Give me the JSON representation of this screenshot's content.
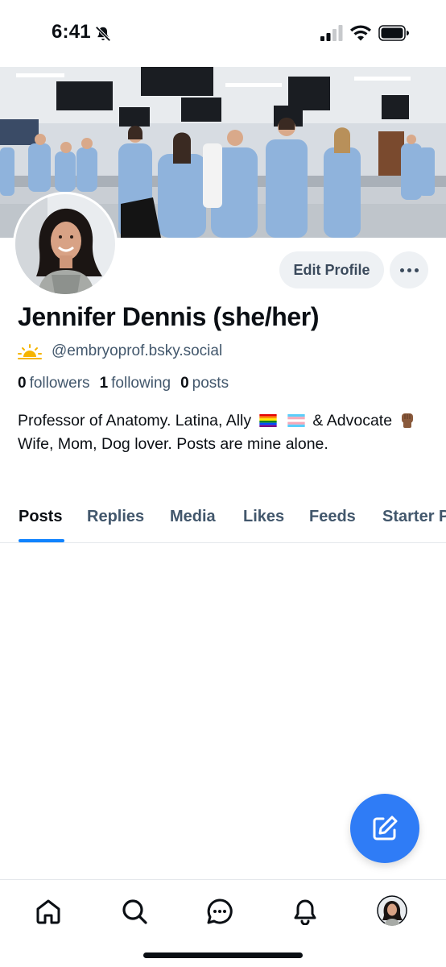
{
  "status_bar": {
    "time": "6:41",
    "icons": [
      "bell-slash-icon",
      "cellular-signal-icon",
      "wifi-icon",
      "battery-icon"
    ]
  },
  "profile": {
    "display_name": "Jennifer Dennis (she/her)",
    "handle": "@embryoprof.bsky.social",
    "handle_icon": "sun-icon",
    "buttons": {
      "edit_profile": "Edit Profile",
      "more": "more-options-icon"
    },
    "stats": {
      "followers_count": "0",
      "followers_label": "followers",
      "following_count": "1",
      "following_label": "following",
      "posts_count": "0",
      "posts_label": "posts"
    },
    "bio": {
      "part1": "Professor of Anatomy. Latina, Ally",
      "part2": "&",
      "part3": "Advocate",
      "part4": "Wife, Mom, Dog lover. Posts are mine alone."
    }
  },
  "tabs": [
    {
      "label": "Posts",
      "active": true
    },
    {
      "label": "Replies",
      "active": false
    },
    {
      "label": "Media",
      "active": false
    },
    {
      "label": "Likes",
      "active": false
    },
    {
      "label": "Feeds",
      "active": false
    },
    {
      "label": "Starter P",
      "active": false
    }
  ],
  "fab": {
    "icon": "compose-icon"
  },
  "bottom_nav": {
    "items": [
      "home-icon",
      "search-icon",
      "chat-icon",
      "notifications-icon",
      "profile-avatar"
    ]
  },
  "colors": {
    "accent": "#1083fe",
    "fab": "#2f7cf6",
    "muted_text": "#42576c",
    "button_bg": "#eef1f4"
  }
}
